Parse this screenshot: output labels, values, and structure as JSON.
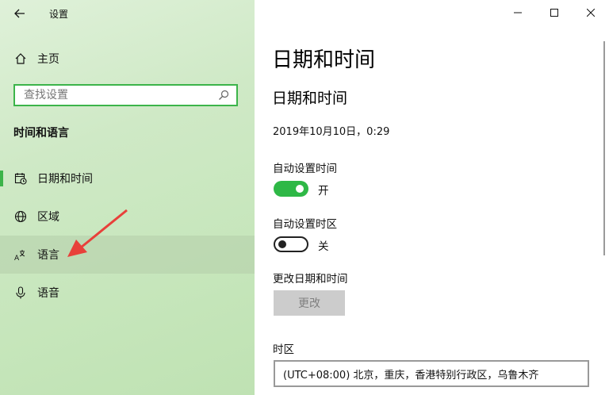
{
  "app": {
    "title": "设置"
  },
  "nav": {
    "home_label": "主页",
    "search_placeholder": "查找设置",
    "section_title": "时间和语言",
    "items": [
      {
        "label": "日期和时间",
        "icon": "calendar-clock-icon",
        "selected": true
      },
      {
        "label": "区域",
        "icon": "globe-icon",
        "selected": false
      },
      {
        "label": "语言",
        "icon": "language-icon",
        "selected": false
      },
      {
        "label": "语音",
        "icon": "microphone-icon",
        "selected": false
      }
    ]
  },
  "window_controls": [
    "minimize-icon",
    "maximize-icon",
    "close-icon"
  ],
  "main": {
    "page_title": "日期和时间",
    "section_title": "日期和时间",
    "current_datetime": "2019年10月10日，0:29",
    "auto_time": {
      "label": "自动设置时间",
      "state": "开",
      "on": true
    },
    "auto_timezone": {
      "label": "自动设置时区",
      "state": "关",
      "on": false
    },
    "change_datetime": {
      "label": "更改日期和时间",
      "button": "更改"
    },
    "timezone": {
      "label": "时区",
      "value": "(UTC+08:00) 北京，重庆，香港特别行政区，乌鲁木齐"
    }
  },
  "colors": {
    "accent": "#3cb44a",
    "toggle_on": "#2eb846",
    "sidebar_bg": "#cfe9c6",
    "annotation_arrow": "#e8403a"
  }
}
